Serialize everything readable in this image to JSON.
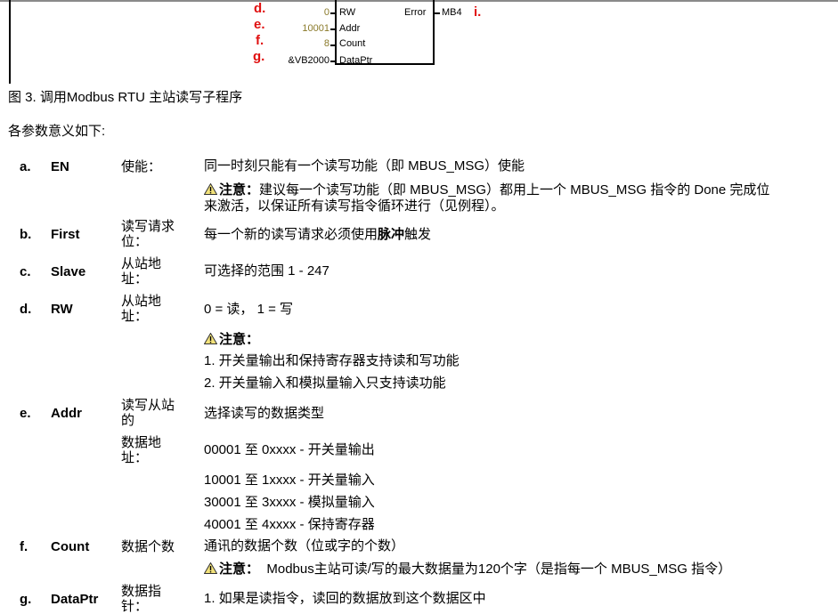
{
  "diagram": {
    "markers": [
      "d.",
      "e.",
      "f.",
      "g.",
      "i."
    ],
    "inputs": [
      {
        "value": "0",
        "pin": "RW"
      },
      {
        "value": "10001",
        "pin": "Addr"
      },
      {
        "value": "8",
        "pin": "Count"
      },
      {
        "value": "&VB2000",
        "pin": "DataPtr"
      }
    ],
    "output": {
      "pin": "Error",
      "value": "MB4"
    }
  },
  "caption": "图  3. 调用Modbus RTU 主站读写子程序",
  "intro": "各参数意义如下:",
  "params": [
    {
      "letter": "a.",
      "name": "EN",
      "desc": "使能：",
      "text": "同一时刻只能有一个读写功能（即  MBUS_MSG）使能",
      "note_label": "注意：",
      "note": "建议每一个读写功能（即  MBUS_MSG）都用上一个  MBUS_MSG 指令的  Done 完成位",
      "note_cont": "来激活，以保证所有读写指令循环进行（见例程）。"
    },
    {
      "letter": "b.",
      "name": "First",
      "desc": "读写请求位：",
      "text_before": "每一个新的读写请求必须使用",
      "text_bold": "脉冲",
      "text_after": "触发"
    },
    {
      "letter": "c.",
      "name": "Slave",
      "desc": "从站地址：",
      "text": "可选择的范围   1 - 247"
    },
    {
      "letter": "d.",
      "name": "RW",
      "desc": "从站地址：",
      "text": "0 =  读，  1 =  写",
      "note_label": "注意：",
      "lines": [
        "1. 开关量输出和保持寄存器支持读和写功能",
        "2. 开关量输入和模拟量输入只支持读功能"
      ]
    },
    {
      "letter": "e.",
      "name": "Addr",
      "desc": "读写从站的",
      "desc2": "数据地址：",
      "text": "选择读写的数据类型",
      "lines": [
        "00001 至  0xxxx - 开关量输出",
        "10001 至  1xxxx - 开关量输入",
        "30001 至  3xxxx - 模拟量输入",
        "40001 至  4xxxx - 保持寄存器"
      ]
    },
    {
      "letter": "f.",
      "name": "Count",
      "desc": "数据个数",
      "text": "通讯的数据个数（位或字的个数）",
      "note_label": "注意：",
      "note": "Modbus主站可读/写的最大数据量为120个字（是指每一个  MBUS_MSG 指令）"
    },
    {
      "letter": "g.",
      "name": "DataPtr",
      "desc": "数据指针：",
      "text": "1. 如果是读指令，读回的数据放到这个数据区中"
    }
  ]
}
